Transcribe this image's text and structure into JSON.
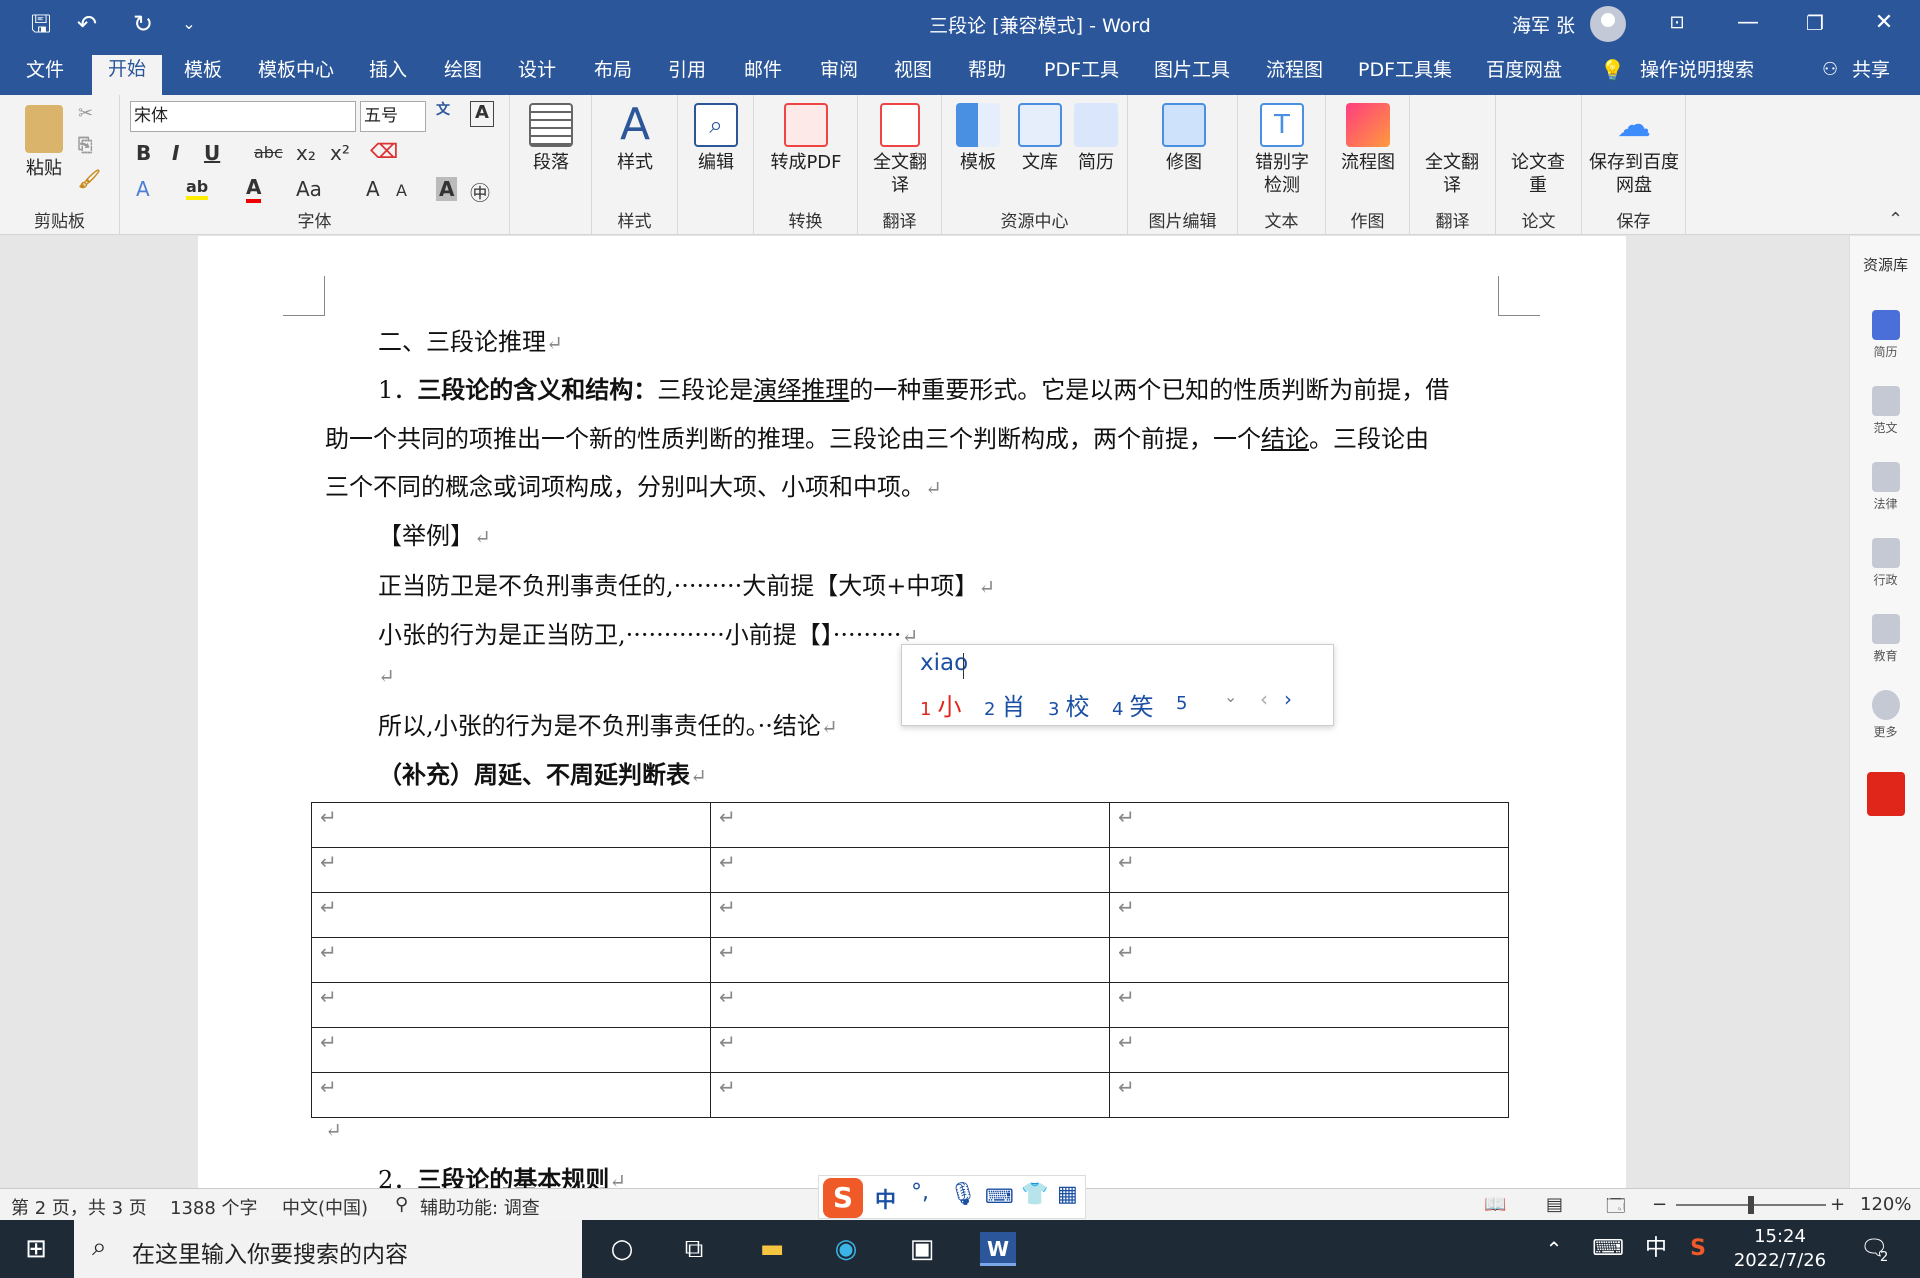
{
  "titlebar": {
    "doc_title": "三段论 [兼容模式]  -  Word",
    "user": "海军 张"
  },
  "menu_tabs": [
    "文件",
    "开始",
    "模板",
    "模板中心",
    "插入",
    "绘图",
    "设计",
    "布局",
    "引用",
    "邮件",
    "审阅",
    "视图",
    "帮助",
    "PDF工具",
    "图片工具",
    "流程图",
    "PDF工具集",
    "百度网盘"
  ],
  "menu_search": "操作说明搜索",
  "share": "共享",
  "ribbon": {
    "clipboard": {
      "paste": "粘贴",
      "label": "剪贴板"
    },
    "font": {
      "name": "宋体",
      "size": "五号",
      "label": "字体"
    },
    "paragraph": "段落",
    "styles": "样式",
    "styles_label": "样式",
    "edit": "编辑",
    "to_pdf": "转成PDF",
    "convert_label": "转换",
    "translate_full": "全文翻译",
    "translate_label": "翻译",
    "template": "模板",
    "library": "文库",
    "resume": "简历",
    "resource_label": "资源中心",
    "edit_image": "修图",
    "image_label": "图片编辑",
    "typo_check": "错别字检测",
    "text_label": "文本",
    "flowchart": "流程图",
    "draw_label": "作图",
    "translate2": "全文翻译",
    "translate2_label": "翻译",
    "plagiarism": "论文查重",
    "paper_label": "论文",
    "save_baidu": "保存到百度网盘",
    "save_label": "保存"
  },
  "document": {
    "h2": "二、三段论推理",
    "p1_num": "1．",
    "p1_bold": "三段论的含义和结构：",
    "p1_a": "三段论是",
    "p1_link": "演绎推理",
    "p1_b": "的一种重要形式。它是以两个已知的性质判断为前提，借",
    "p2_a": "助一个共同的项推出一个新的性质判断的推理。三段论由三个判断构成，两个前提，一个",
    "p2_link": "结论",
    "p2_b": "。三段论由",
    "p3": "三个不同的概念或词项构成，分别叫大项、小项和中项。",
    "ex_head": "【举例】",
    "ex1": "正当防卫是不负刑事责任的,·········大前提【大项+中项】",
    "ex2": "小张的行为是正当防卫,·············小前提【】·········",
    "ex3": "所以,小张的行为是不负刑事责任的。··结论",
    "supp": "（补充）周延、不周延判断表",
    "s2_num": "2．",
    "s2": "三段论的基本规则"
  },
  "table": {
    "rows": 7,
    "cols": 3,
    "cell_mark": "↵"
  },
  "ime": {
    "composition": "xiao",
    "candidates": [
      {
        "n": "1",
        "c": "小"
      },
      {
        "n": "2",
        "c": "肖"
      },
      {
        "n": "3",
        "c": "校"
      },
      {
        "n": "4",
        "c": "笑"
      },
      {
        "n": "5",
        "c": ""
      }
    ]
  },
  "right_panel": {
    "title": "资源库",
    "items": [
      "简历",
      "范文",
      "法律",
      "行政",
      "教育",
      "更多"
    ]
  },
  "status": {
    "page": "第 2 页，共 3 页",
    "words": "1388 个字",
    "lang": "中文(中国)",
    "access": "辅助功能: 调查",
    "zoom": "120%"
  },
  "taskbar": {
    "search_placeholder": "在这里输入你要搜索的内容",
    "time": "15:24",
    "date": "2022/7/26",
    "ime_lang": "中",
    "notif": "2"
  },
  "colors": {
    "word_blue": "#2b579a",
    "ime_blue": "#1a4fa3",
    "ime_red": "#e0261b"
  }
}
